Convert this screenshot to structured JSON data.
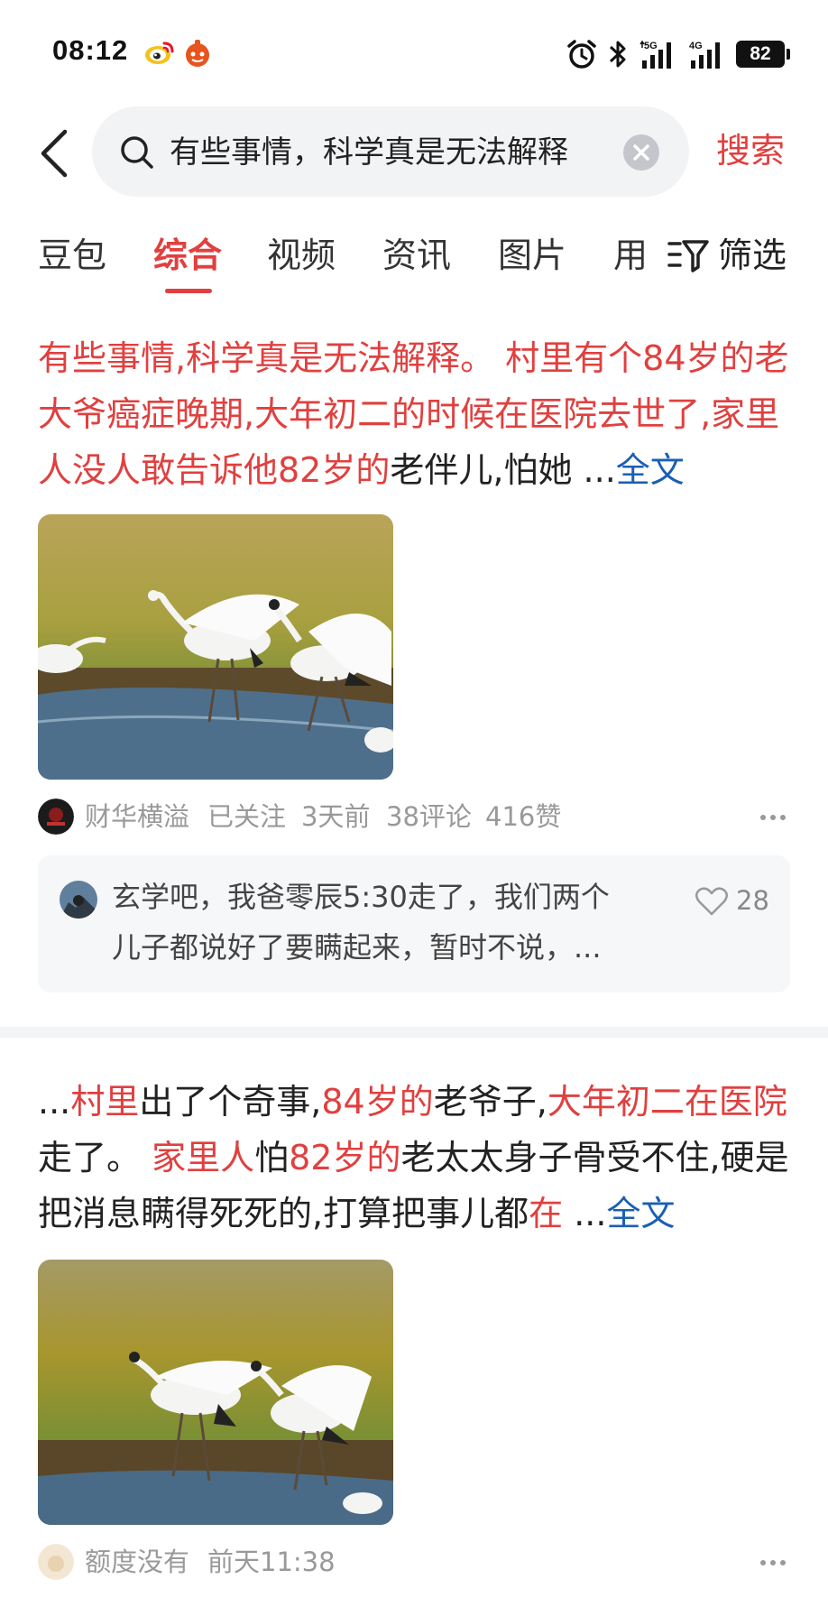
{
  "status_bar": {
    "time": "08:12",
    "network": "5G",
    "network2": "4G",
    "battery": "82",
    "icons": [
      "weibo-icon",
      "app-icon",
      "alarm-icon",
      "bluetooth-icon",
      "signal-icon",
      "signal-icon",
      "battery-icon"
    ]
  },
  "search": {
    "query": "有些事情，科学真是无法解释",
    "button_label": "搜索"
  },
  "tabs": [
    {
      "label": "豆包"
    },
    {
      "label": "综合",
      "active": true
    },
    {
      "label": "视频"
    },
    {
      "label": "资讯"
    },
    {
      "label": "图片"
    },
    {
      "label": "用"
    }
  ],
  "filter": {
    "label": "筛选"
  },
  "colors": {
    "accent": "#e0403f",
    "link": "#1a5fb4",
    "meta": "#999999"
  },
  "results": [
    {
      "snippet_segments": [
        {
          "text": "有些事情,科学真是无法解释。 村里有个84岁的老大爷癌症晚期,大年初二的时候在医院去世了,家里人没人敢告诉他82岁的",
          "hl": true
        },
        {
          "text": "老伴儿,怕她 ",
          "hl": false
        }
      ],
      "more": "...",
      "full_text_link": "全文",
      "author": "财华横溢",
      "follow_status": "已关注",
      "time": "3天前",
      "comments": "38评论",
      "likes": "416赞",
      "top_comment": {
        "text": "玄学吧，我爸零辰5:30走了，我们两个儿子都说好了要瞒起来，暂时不说，...",
        "likes": "28"
      }
    },
    {
      "snippet_segments": [
        {
          "text": "...",
          "hl": false
        },
        {
          "text": "村里",
          "hl": true
        },
        {
          "text": "出了个奇事,",
          "hl": false
        },
        {
          "text": "84岁的",
          "hl": true
        },
        {
          "text": "老爷子,",
          "hl": false
        },
        {
          "text": "大年初二在医院",
          "hl": true
        },
        {
          "text": "走了。 ",
          "hl": false
        },
        {
          "text": "家里人",
          "hl": true
        },
        {
          "text": "怕",
          "hl": false
        },
        {
          "text": "82岁的",
          "hl": true
        },
        {
          "text": "老太太身子骨受不住,硬是把消息瞒得死死的,打算把事儿都",
          "hl": false
        },
        {
          "text": "在",
          "hl": true
        },
        {
          "text": " ",
          "hl": false
        }
      ],
      "more": "...",
      "full_text_link": "全文",
      "author": "额度没有",
      "time": "前天11:38"
    }
  ]
}
